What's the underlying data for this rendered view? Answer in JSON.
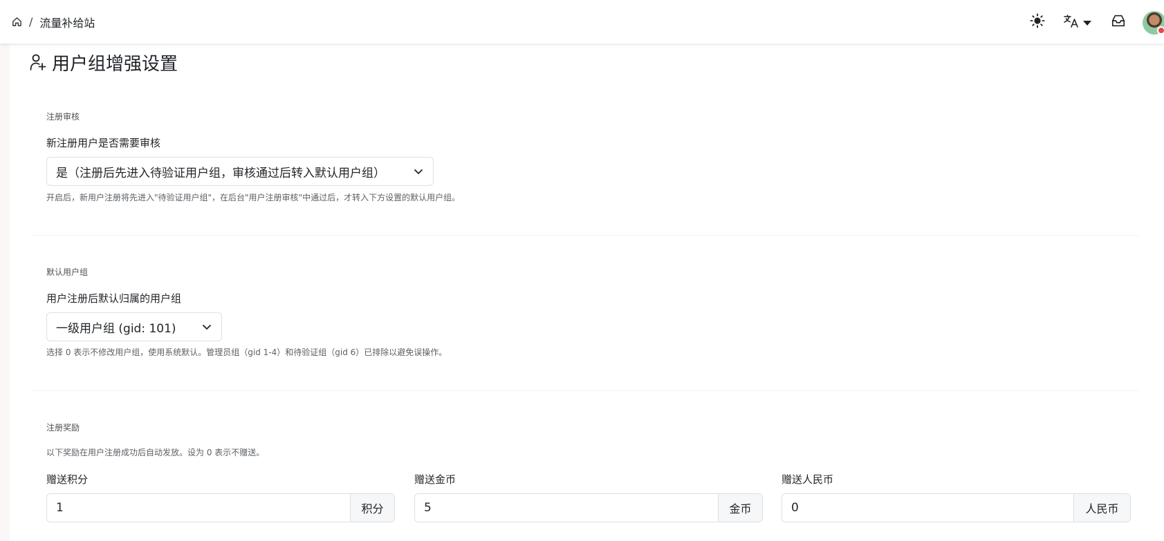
{
  "header": {
    "breadcrumb_separator": "/",
    "site_name": "流量补给站"
  },
  "page": {
    "title": "用户组增强设置"
  },
  "registration_review": {
    "caption": "注册审核",
    "label": "新注册用户是否需要审核",
    "selected": "是（注册后先进入待验证用户组，审核通过后转入默认用户组）",
    "help": "开启后，新用户注册将先进入\"待验证用户组\"，在后台\"用户注册审核\"中通过后，才转入下方设置的默认用户组。"
  },
  "default_group": {
    "caption": "默认用户组",
    "label": "用户注册后默认归属的用户组",
    "selected": "一级用户组 (gid: 101)",
    "help": "选择 0 表示不修改用户组，使用系统默认。管理员组（gid 1-4）和待验证组（gid 6）已排除以避免误操作。"
  },
  "registration_reward": {
    "caption": "注册奖励",
    "help": "以下奖励在用户注册成功后自动发放。设为 0 表示不赠送。",
    "points": {
      "label": "赠送积分",
      "value": "1",
      "unit": "积分"
    },
    "gold": {
      "label": "赠送金币",
      "value": "5",
      "unit": "金币"
    },
    "rmb": {
      "label": "赠送人民币",
      "value": "0",
      "unit": "人民币"
    }
  },
  "icons": {
    "home": "home-icon",
    "theme": "sun-icon",
    "language": "translate-icon",
    "inbox": "inbox-icon",
    "user_plus": "user-plus-icon",
    "chevron": "chevron-down-icon"
  },
  "colors": {
    "border": "#dcdfe3",
    "addon_bg": "#f6f7f8",
    "muted_text": "#5c6166",
    "notification_badge": "#e5484d"
  }
}
